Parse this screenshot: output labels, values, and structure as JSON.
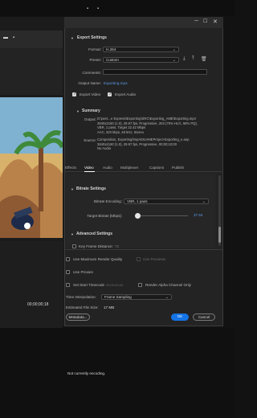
{
  "dialog": {
    "export_settings": {
      "header": "Export Settings",
      "format_label": "Format:",
      "format_value": "H.264",
      "preset_label": "Preset:",
      "preset_value": "Custom",
      "comments_label": "Comments:",
      "comments_value": "",
      "output_name_label": "Output Name:",
      "output_name_value": "Exporting.mp4",
      "export_video_label": "Export Video",
      "export_audio_label": "Export Audio",
      "export_video_checked": true,
      "export_audio_checked": true
    },
    "summary": {
      "header": "Summary",
      "output_label": "Output:",
      "output_lines": [
        "D:\\pers...e Express\\Exporting\\SRC\\Exporting_AME\\Exporting.mp4",
        "3840x2160 (1.0), 29.97 fps, Progressive, 203 (75% HLG, 58% PQ),",
        "VBR, 1 pass, Target 22.42 Mbps",
        "AAC, 320 kbps, 48 kHz, Stereo"
      ],
      "source_label": "Source:",
      "source_lines": [
        "Composition, Exporting/tmpAEtoAMEProject-Exporting_e.aep",
        "3840x2160 (1.0), 29.97 fps, Progressive, 00;00;10;00",
        "No Audio"
      ]
    },
    "tabs": [
      "Effects",
      "Video",
      "Audio",
      "Multiplexer",
      "Captions",
      "Publish"
    ],
    "active_tab": "Video",
    "bitrate": {
      "header": "Bitrate Settings",
      "encoding_label": "Bitrate Encoding:",
      "encoding_value": "VBR, 1 pass",
      "target_label": "Target Bitrate [Mbps]:",
      "target_value": "37.54",
      "target_fraction": 0.04
    },
    "advanced": {
      "header": "Advanced Settings",
      "keyframe_label": "Key Frame Distance:",
      "keyframe_value": "72"
    },
    "bottom": {
      "max_render_quality": "Use Maximum Render Quality",
      "use_previews": "Use Previews",
      "use_proxies": "Use Proxies",
      "set_start_timecode": "Set Start Timecode",
      "start_timecode_value": "00;00;00;00",
      "render_alpha": "Render Alpha Channel Only",
      "time_interp_label": "Time Interpolation:",
      "time_interp_value": "Frame Sampling",
      "file_size_label": "Estimated File Size:",
      "file_size_value": "17 MB",
      "metadata_button": "Metadata...",
      "ok_button": "OK",
      "cancel_button": "Cancel"
    }
  },
  "timeline": {
    "timecode": "00;00;00;18"
  },
  "status": {
    "encoding": "Not currently encoding."
  },
  "colors": {
    "accent": "#1473e6",
    "link": "#5b9be6",
    "dialog_bg": "#232323"
  }
}
